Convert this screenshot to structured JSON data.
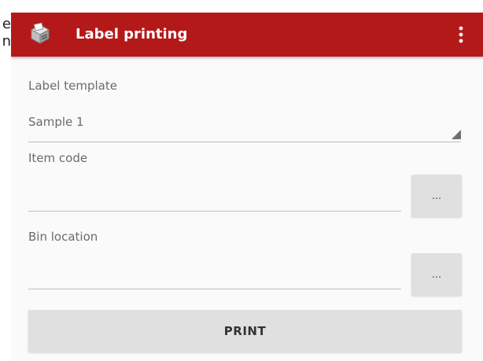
{
  "edge_text": {
    "line1": "e",
    "line2": "n"
  },
  "appbar": {
    "icon": "printer-icon",
    "title": "Label printing",
    "menu_icon": "more-vert-icon",
    "color": "#b41919"
  },
  "form": {
    "label_template": {
      "label": "Label template",
      "value": "Sample 1"
    },
    "item_code": {
      "label": "Item code",
      "value": "",
      "lookup_label": "..."
    },
    "bin_location": {
      "label": "Bin location",
      "value": "",
      "lookup_label": "..."
    },
    "print_label": "PRINT"
  }
}
